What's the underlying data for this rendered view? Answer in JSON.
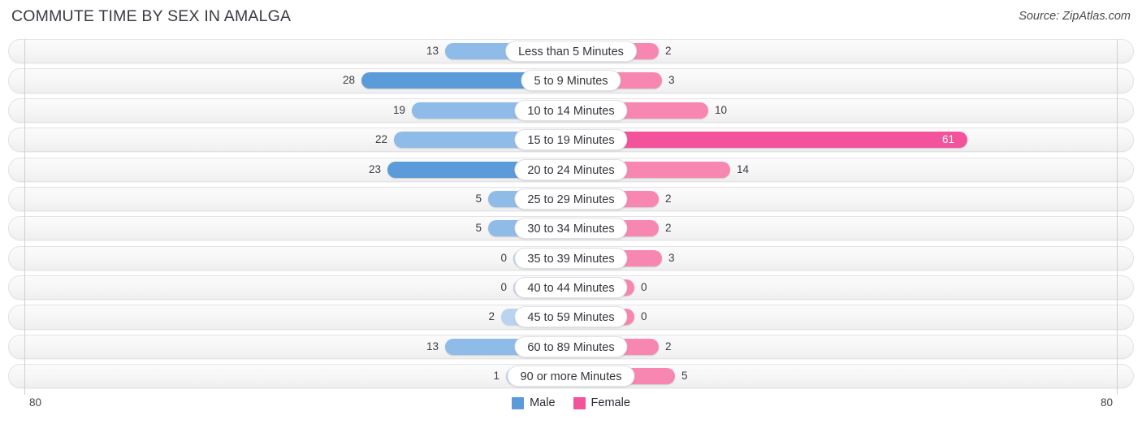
{
  "header": {
    "title": "COMMUTE TIME BY SEX IN AMALGA",
    "source": "Source: ZipAtlas.com"
  },
  "axis": {
    "left_label": "80",
    "right_label": "80",
    "max": 80
  },
  "legend": {
    "items": [
      {
        "label": "Male",
        "color": "#5b9bd9"
      },
      {
        "label": "Female",
        "color": "#f2539a"
      }
    ]
  },
  "chart_data": {
    "type": "bar",
    "orientation": "horizontal-diverging",
    "title": "COMMUTE TIME BY SEX IN AMALGA",
    "subtitle": "Source: ZipAtlas.com",
    "xlabel": "",
    "ylabel": "",
    "xlim": [
      80,
      80
    ],
    "grid": false,
    "legend_position": "bottom-center",
    "categories": [
      "Less than 5 Minutes",
      "5 to 9 Minutes",
      "10 to 14 Minutes",
      "15 to 19 Minutes",
      "20 to 24 Minutes",
      "25 to 29 Minutes",
      "30 to 34 Minutes",
      "35 to 39 Minutes",
      "40 to 44 Minutes",
      "45 to 59 Minutes",
      "60 to 89 Minutes",
      "90 or more Minutes"
    ],
    "series": [
      {
        "name": "Male",
        "color": "#5b9bd9",
        "values": [
          13,
          28,
          19,
          22,
          23,
          5,
          5,
          0,
          0,
          2,
          13,
          1
        ]
      },
      {
        "name": "Female",
        "color": "#f2539a",
        "values": [
          2,
          3,
          10,
          61,
          14,
          2,
          2,
          3,
          0,
          0,
          2,
          5
        ]
      }
    ]
  },
  "rows": [
    {
      "label": "Less than 5 Minutes",
      "male": "13",
      "female": "2",
      "male_w": 155,
      "female_w": 108,
      "male_tone": "light",
      "female_tone": "mid",
      "female_inside": false
    },
    {
      "label": "5 to 9 Minutes",
      "male": "28",
      "female": "3",
      "male_w": 258,
      "female_w": 112,
      "male_tone": "",
      "female_tone": "mid",
      "female_inside": false
    },
    {
      "label": "10 to 14 Minutes",
      "male": "19",
      "female": "10",
      "male_w": 196,
      "female_w": 169,
      "male_tone": "light",
      "female_tone": "mid",
      "female_inside": false
    },
    {
      "label": "15 to 19 Minutes",
      "male": "22",
      "female": "61",
      "male_w": 218,
      "female_w": 488,
      "male_tone": "light",
      "female_tone": "strong",
      "female_inside": true
    },
    {
      "label": "20 to 24 Minutes",
      "male": "23",
      "female": "14",
      "male_w": 226,
      "female_w": 196,
      "male_tone": "",
      "female_tone": "mid",
      "female_inside": false
    },
    {
      "label": "25 to 29 Minutes",
      "male": "5",
      "female": "2",
      "male_w": 102,
      "female_w": 108,
      "male_tone": "light",
      "female_tone": "mid",
      "female_inside": false
    },
    {
      "label": "30 to 34 Minutes",
      "male": "5",
      "female": "2",
      "male_w": 102,
      "female_w": 108,
      "male_tone": "light",
      "female_tone": "mid",
      "female_inside": false
    },
    {
      "label": "35 to 39 Minutes",
      "male": "0",
      "female": "3",
      "male_w": 71,
      "female_w": 112,
      "male_tone": "lighter",
      "female_tone": "mid",
      "female_inside": false
    },
    {
      "label": "40 to 44 Minutes",
      "male": "0",
      "female": "0",
      "male_w": 71,
      "female_w": 78,
      "male_tone": "lighter",
      "female_tone": "mid",
      "female_inside": false
    },
    {
      "label": "45 to 59 Minutes",
      "male": "2",
      "female": "0",
      "male_w": 86,
      "female_w": 78,
      "male_tone": "lighter",
      "female_tone": "mid",
      "female_inside": false
    },
    {
      "label": "60 to 89 Minutes",
      "male": "13",
      "female": "2",
      "male_w": 155,
      "female_w": 108,
      "male_tone": "light",
      "female_tone": "mid",
      "female_inside": false
    },
    {
      "label": "90 or more Minutes",
      "male": "1",
      "female": "5",
      "male_w": 80,
      "female_w": 128,
      "male_tone": "lighter",
      "female_tone": "mid",
      "female_inside": false
    }
  ]
}
